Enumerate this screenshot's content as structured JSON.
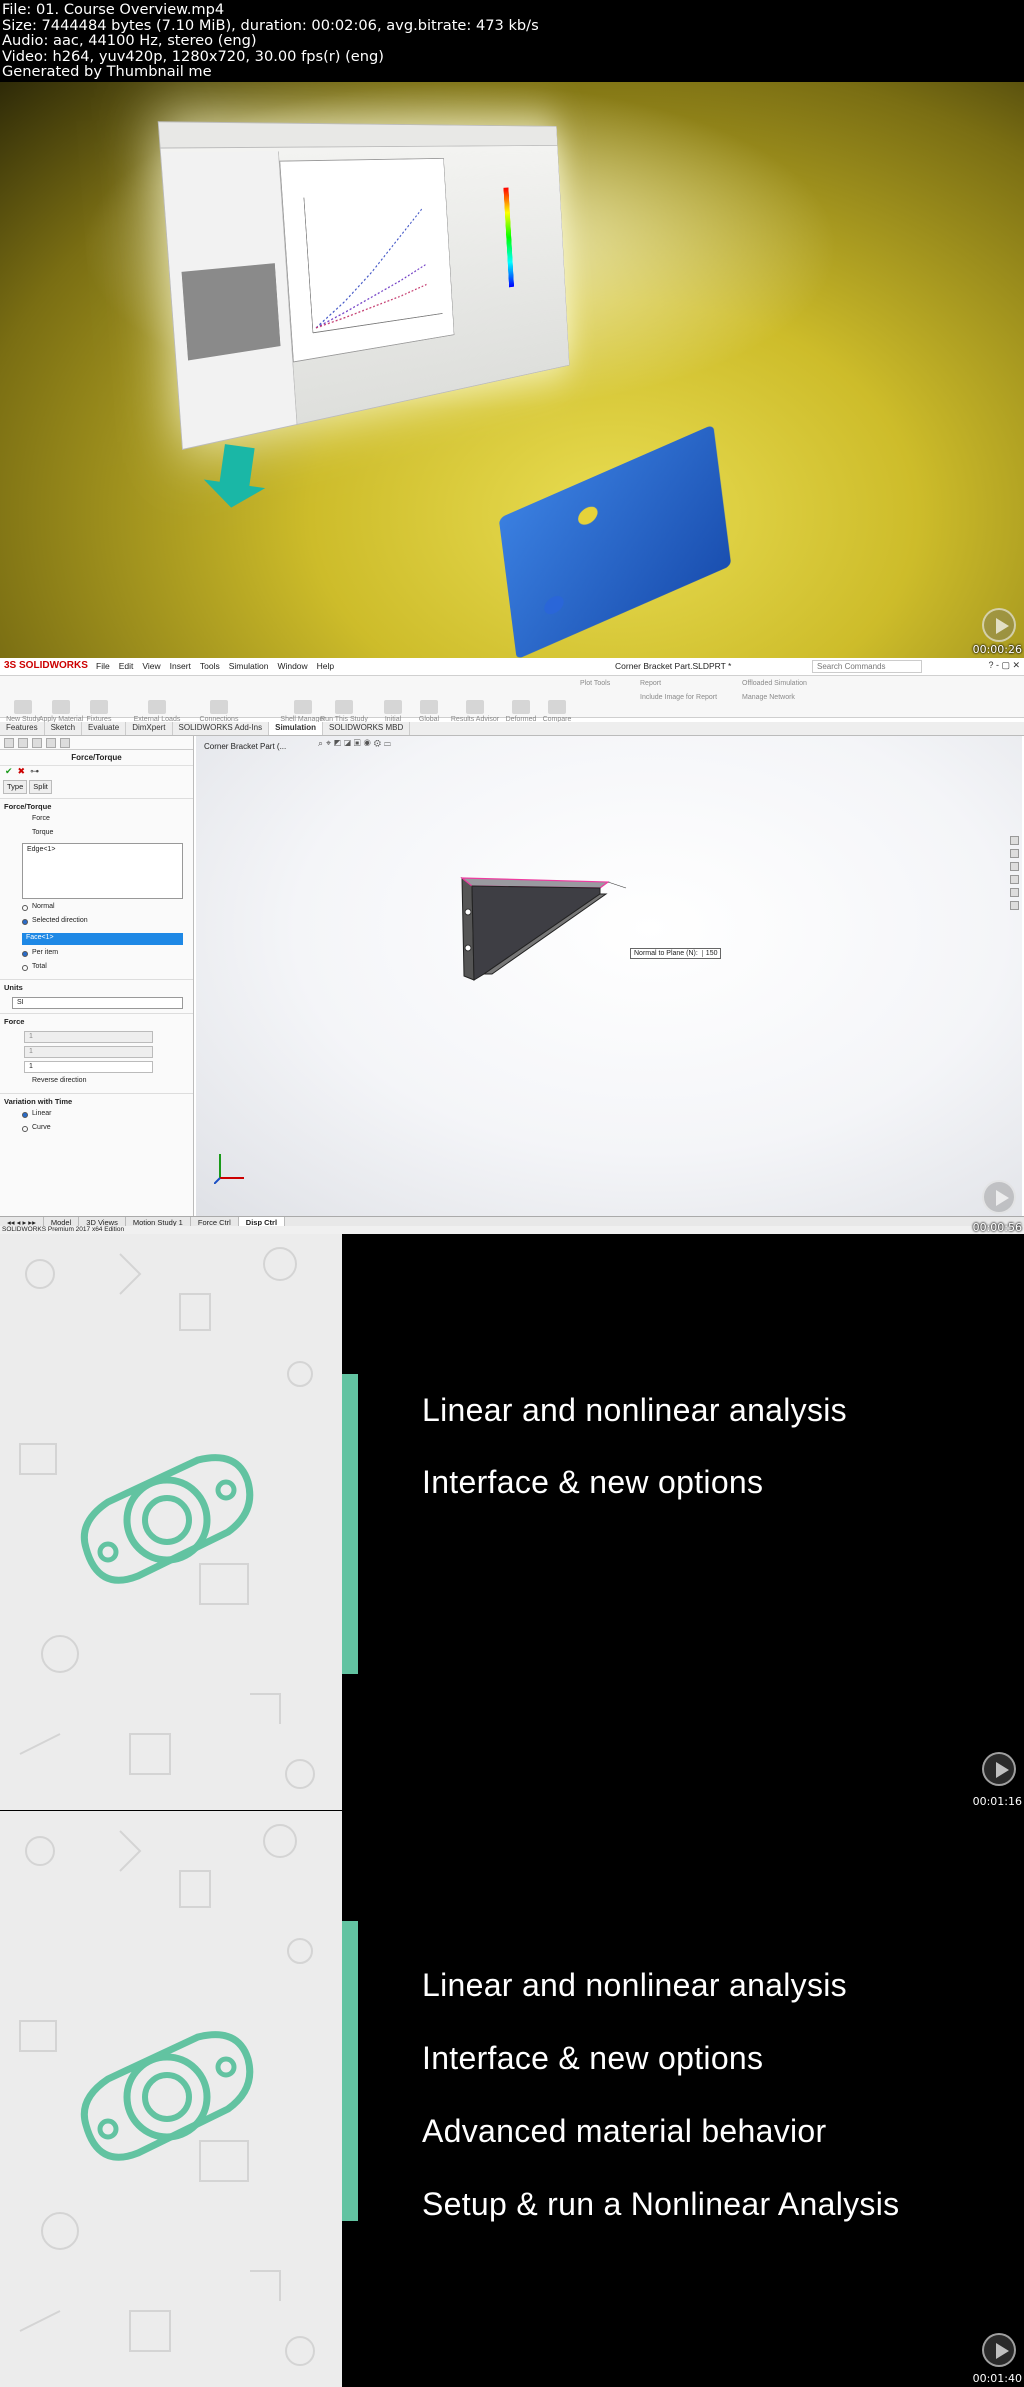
{
  "header": {
    "file": "File: 01. Course Overview.mp4",
    "size": "Size: 7444484 bytes (7.10 MiB), duration: 00:02:06, avg.bitrate: 473 kb/s",
    "audio": "Audio: aac, 44100 Hz, stereo (eng)",
    "video": "Video: h264, yuv420p, 1280x720, 30.00 fps(r) (eng)",
    "generator": "Generated by Thumbnail me"
  },
  "frames": {
    "f1": {
      "timestamp": "00:00:26"
    },
    "f2": {
      "timestamp": "00:00:56"
    },
    "f3": {
      "timestamp": "00:01:16"
    },
    "f4": {
      "timestamp": "00:01:40"
    }
  },
  "sw": {
    "logo": "3S SOLIDWORKS",
    "menu": [
      "File",
      "Edit",
      "View",
      "Insert",
      "Tools",
      "Simulation",
      "Window",
      "Help"
    ],
    "doc_title": "Corner Bracket Part.SLDPRT *",
    "search_placeholder": "Search Commands",
    "win_buttons": "? - ▢ ✕",
    "commands": [
      "New Study",
      "Apply Material",
      "Fixtures Advisor",
      "External Loads Advisor",
      "Connections Advisor",
      "Shell Manager",
      "Run This Study",
      "Initial Condition",
      "Global Damping",
      "Results Advisor",
      "Deformed Result",
      "Compare Results",
      "Plot Tools",
      "Report",
      "Include Image for Report",
      "Offloaded Simulation",
      "Manage Network"
    ],
    "tabs": [
      "Features",
      "Sketch",
      "Evaluate",
      "DimXpert",
      "SOLIDWORKS Add-Ins",
      "Simulation",
      "SOLIDWORKS MBD"
    ],
    "active_tab": "Simulation",
    "pm": {
      "title": "Force/Torque",
      "type_tab": "Type",
      "split_tab": "Split",
      "section_force_torque": "Force/Torque",
      "opt_force": "Force",
      "opt_torque": "Torque",
      "list_item": "Edge<1>",
      "opt_normal": "Normal",
      "opt_selected_direction": "Selected direction",
      "face_sel": "Face<1>",
      "opt_per_item": "Per item",
      "opt_total": "Total",
      "section_units": "Units",
      "units_value": "SI",
      "section_force": "Force",
      "force_unit": "N",
      "field1": "1",
      "field2": "1",
      "field3": "1",
      "reverse": "Reverse direction",
      "section_variation": "Variation with Time",
      "opt_linear": "Linear",
      "opt_curve": "Curve"
    },
    "tree_item": "Corner Bracket Part  (...",
    "callout_label": "Normal to Plane (N):",
    "callout_value": "150",
    "bottom_tabs": [
      "Model",
      "3D Views",
      "Motion Study 1",
      "Force Ctrl",
      "Disp Ctrl"
    ],
    "bottom_active": "Disp Ctrl",
    "status": "SOLIDWORKS Premium 2017 x64 Edition"
  },
  "slide3": {
    "bullets": [
      "Linear and nonlinear analysis",
      "Interface & new options"
    ]
  },
  "slide4": {
    "bullets": [
      "Linear and nonlinear analysis",
      "Interface & new options",
      "Advanced material behavior",
      "Setup & run a Nonlinear Analysis"
    ]
  },
  "colors": {
    "accent_green": "#62c3a1",
    "sw_red": "#cc0000",
    "selection_blue": "#1e88e5"
  }
}
